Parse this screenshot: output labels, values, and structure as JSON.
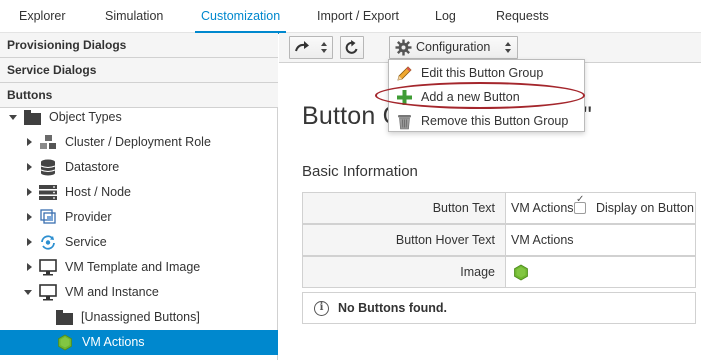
{
  "nav": {
    "tabs": [
      {
        "label": "Explorer"
      },
      {
        "label": "Simulation"
      },
      {
        "label": "Customization",
        "active": true
      },
      {
        "label": "Import / Export"
      },
      {
        "label": "Log"
      },
      {
        "label": "Requests"
      }
    ]
  },
  "accordion": {
    "headers": [
      "Provisioning Dialogs",
      "Service Dialogs",
      "Buttons"
    ],
    "tree": [
      {
        "label": "Object Types",
        "icon": "folder-icon",
        "state": "expanded"
      },
      {
        "label": "Cluster / Deployment Role",
        "icon": "cluster-icon",
        "state": "collapsed"
      },
      {
        "label": "Datastore",
        "icon": "database-icon",
        "state": "collapsed"
      },
      {
        "label": "Host / Node",
        "icon": "server-icon",
        "state": "collapsed"
      },
      {
        "label": "Provider",
        "icon": "provider-icon",
        "state": "collapsed"
      },
      {
        "label": "Service",
        "icon": "service-icon",
        "state": "collapsed"
      },
      {
        "label": "VM Template and Image",
        "icon": "monitor-icon",
        "state": "collapsed"
      },
      {
        "label": "VM and Instance",
        "icon": "monitor-icon",
        "state": "expanded"
      },
      {
        "label": "[Unassigned Buttons]",
        "icon": "folder-icon",
        "state": "leaf"
      },
      {
        "label": "VM Actions",
        "icon": "green-hexagon-icon",
        "state": "selected"
      }
    ]
  },
  "toolbar": {
    "config_label": "Configuration"
  },
  "main": {
    "title_start": "Button G",
    "title_end": "\"",
    "section_title": "Basic Information",
    "rows": [
      {
        "label": "Button Text",
        "value": "VM Actions",
        "checkbox_label": "Display on Button",
        "checked": true
      },
      {
        "label": "Button Hover Text",
        "value": "VM Actions"
      },
      {
        "label": "Image",
        "icon": "green-hexagon-icon"
      }
    ],
    "alert_text": "No Buttons found."
  },
  "dropdown": {
    "items": [
      {
        "label": "Edit this Button Group",
        "icon": "pencil-icon"
      },
      {
        "label": "Add a new Button",
        "icon": "plus-icon",
        "highlighted": true
      },
      {
        "label": "Remove this Button Group",
        "icon": "trash-icon"
      }
    ]
  },
  "colors": {
    "accent": "#0088ce",
    "highlight_ring": "#a4262c",
    "hexagon": "#6fb630",
    "plus": "#3f9c35"
  }
}
